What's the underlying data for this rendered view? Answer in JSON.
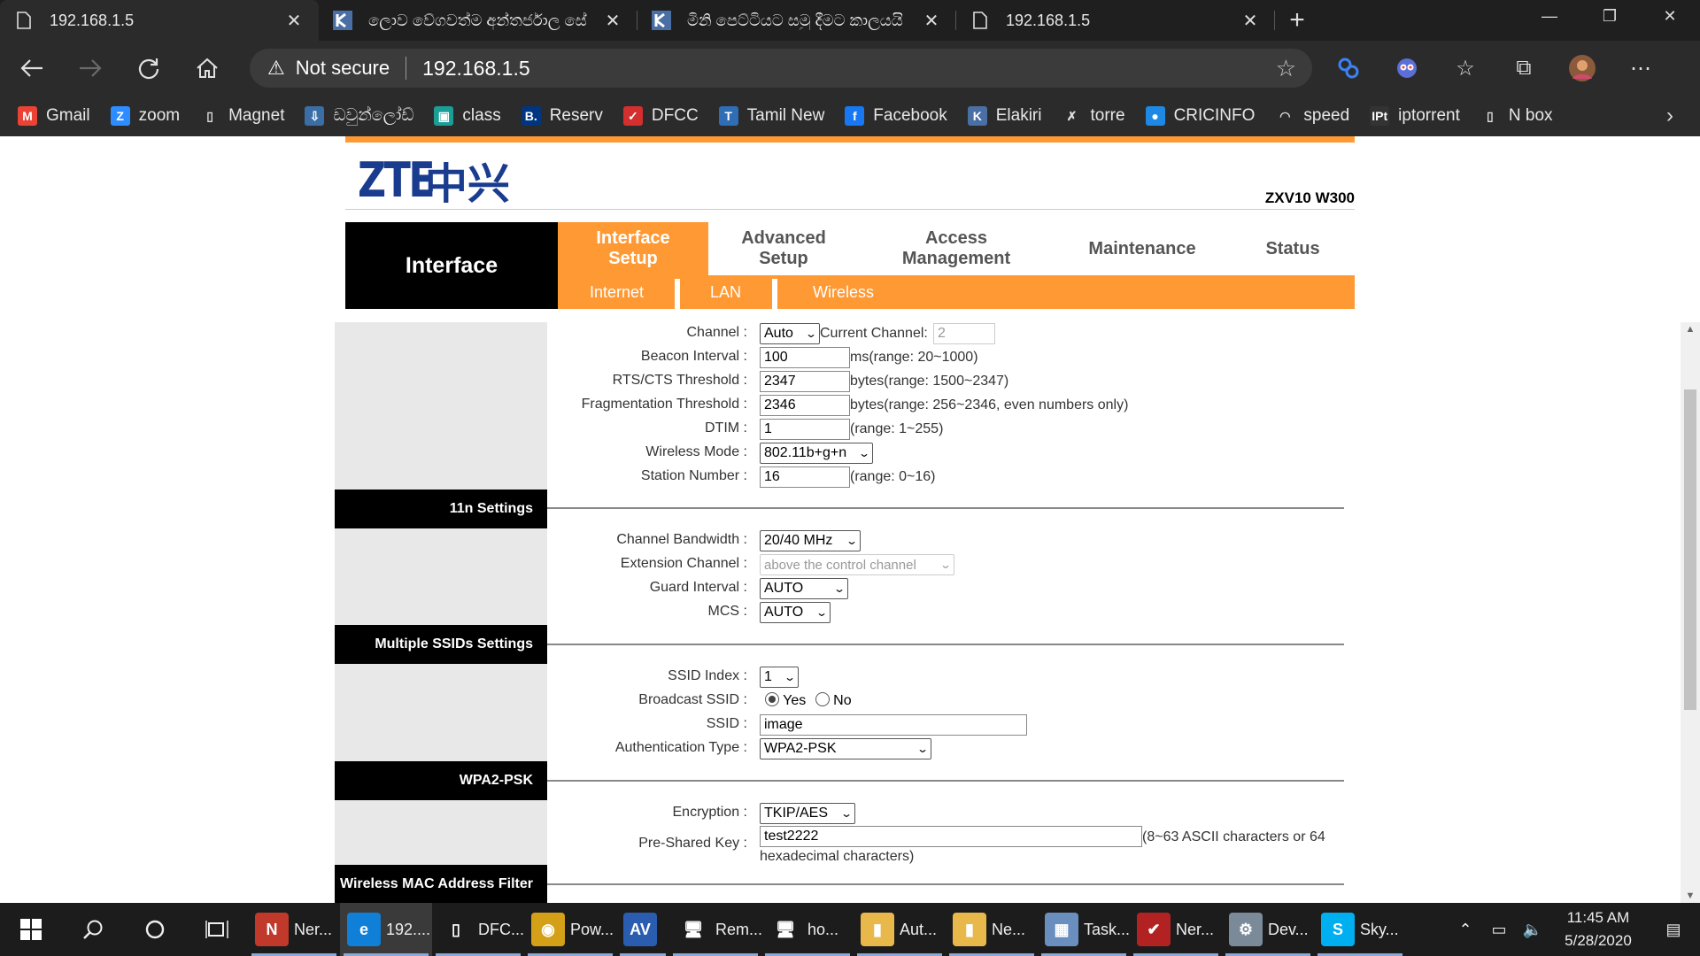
{
  "browser": {
    "tabs": [
      {
        "title": "192.168.1.5",
        "icon": "page-icon",
        "active": true
      },
      {
        "title": "ලොව වේගවත්ම අන්තර්ජාල සේ",
        "icon": "k-logo-icon",
        "active": false
      },
      {
        "title": "මිනි පෙට්ටියට සමු දීමට කාලයයි",
        "icon": "k-logo-icon",
        "active": false
      },
      {
        "title": "192.168.1.5",
        "icon": "page-icon",
        "active": false
      }
    ],
    "tab_close": "✕",
    "new_tab": "+",
    "window_controls": {
      "minimize": "—",
      "maximize": "❐",
      "close": "✕"
    },
    "address": {
      "security": "Not secure",
      "url": "192.168.1.5"
    },
    "bookmarks": [
      {
        "label": "Gmail",
        "icon": "gmail-icon",
        "color": "#ea4335",
        "glyph": "M"
      },
      {
        "label": "zoom",
        "icon": "zoom-icon",
        "color": "#2d8cff",
        "glyph": "Z"
      },
      {
        "label": "Magnet",
        "icon": "page-icon",
        "color": "transparent",
        "glyph": "▯"
      },
      {
        "label": "ඩවුන්ලෝඩ්",
        "icon": "download-icon",
        "color": "#3a6ea5",
        "glyph": "⇩"
      },
      {
        "label": "class",
        "icon": "class-icon",
        "color": "#1a9e96",
        "glyph": "▣"
      },
      {
        "label": "Reserv",
        "icon": "booking-icon",
        "color": "#003580",
        "glyph": "B."
      },
      {
        "label": "DFCC",
        "icon": "check-icon",
        "color": "#d32f2f",
        "glyph": "✓"
      },
      {
        "label": "Tamil New",
        "icon": "t-logo-icon",
        "color": "#2f6db5",
        "glyph": "T"
      },
      {
        "label": "Facebook",
        "icon": "facebook-icon",
        "color": "#1877f2",
        "glyph": "f"
      },
      {
        "label": "Elakiri",
        "icon": "k-logo-icon",
        "color": "#4a6fa5",
        "glyph": "K"
      },
      {
        "label": "torre",
        "icon": "x-logo-icon",
        "color": "transparent",
        "glyph": "✗"
      },
      {
        "label": "CRICINFO",
        "icon": "cricinfo-icon",
        "color": "#1e88e5",
        "glyph": "●"
      },
      {
        "label": "speed",
        "icon": "speed-icon",
        "color": "transparent",
        "glyph": "◠"
      },
      {
        "label": "iptorrent",
        "icon": "ipt-icon",
        "color": "#333333",
        "glyph": "IPt"
      },
      {
        "label": "N box",
        "icon": "page-icon",
        "color": "transparent",
        "glyph": "▯"
      }
    ]
  },
  "router": {
    "logo_text": "ZTE",
    "logo_cn": "中兴",
    "model": "ZXV10 W300",
    "menu_left": "Interface",
    "menu": [
      {
        "label": "Interface Setup",
        "active": true
      },
      {
        "label": "Advanced Setup",
        "active": false
      },
      {
        "label": "Access Management",
        "active": false
      },
      {
        "label": "Maintenance",
        "active": false
      },
      {
        "label": "Status",
        "active": false
      }
    ],
    "submenu": [
      "Internet",
      "LAN",
      "Wireless"
    ],
    "accent_color": "#ff9933",
    "wireless": {
      "channel": {
        "label": "Channel",
        "value": "Auto",
        "current_label": "Current Channel:",
        "current_value": "2"
      },
      "beacon": {
        "label": "Beacon Interval",
        "value": "100",
        "hint": "ms(range: 20~1000)"
      },
      "rts": {
        "label": "RTS/CTS Threshold",
        "value": "2347",
        "hint": "bytes(range: 1500~2347)"
      },
      "frag": {
        "label": "Fragmentation Threshold",
        "value": "2346",
        "hint": "bytes(range: 256~2346, even numbers only)"
      },
      "dtim": {
        "label": "DTIM",
        "value": "1",
        "hint": "(range: 1~255)"
      },
      "mode": {
        "label": "Wireless Mode",
        "value": "802.11b+g+n"
      },
      "station": {
        "label": "Station Number",
        "value": "16",
        "hint": "(range: 0~16)"
      }
    },
    "n_settings": {
      "title": "11n Settings",
      "bandwidth": {
        "label": "Channel Bandwidth",
        "value": "20/40 MHz"
      },
      "ext_channel": {
        "label": "Extension Channel",
        "value": "above the control channel"
      },
      "guard": {
        "label": "Guard Interval",
        "value": "AUTO"
      },
      "mcs": {
        "label": "MCS",
        "value": "AUTO"
      }
    },
    "ssid_settings": {
      "title": "Multiple SSIDs Settings",
      "index": {
        "label": "SSID Index",
        "value": "1"
      },
      "broadcast": {
        "label": "Broadcast SSID",
        "yes": "Yes",
        "no": "No",
        "selected": "Yes"
      },
      "ssid": {
        "label": "SSID",
        "value": "image"
      },
      "auth": {
        "label": "Authentication Type",
        "value": "WPA2-PSK"
      }
    },
    "wpa": {
      "title": "WPA2-PSK",
      "encryption": {
        "label": "Encryption",
        "value": "TKIP/AES"
      },
      "psk": {
        "label": "Pre-Shared Key",
        "value": "test2222",
        "hint1": "(8~63 ASCII characters or 64",
        "hint2": "hexadecimal characters)"
      }
    },
    "mac_filter": {
      "title": "Wireless MAC Address Filter"
    },
    "colon": ":"
  },
  "taskbar": {
    "apps": [
      {
        "label": "Ner...",
        "icon": "nero-icon",
        "color": "#c0392b",
        "glyph": "N",
        "active": false
      },
      {
        "label": "192....",
        "icon": "edge-icon",
        "color": "#0f7fd8",
        "glyph": "e",
        "active": true
      },
      {
        "label": "DFC...",
        "icon": "document-icon",
        "color": "transparent",
        "glyph": "▯",
        "active": false
      },
      {
        "label": "Pow...",
        "icon": "power-dvd-icon",
        "color": "#d4a017",
        "glyph": "◉",
        "active": false
      },
      {
        "label": "",
        "icon": "nero-av-icon",
        "color": "#2a5db0",
        "glyph": "AV",
        "active": false
      },
      {
        "label": "Rem...",
        "icon": "remote-desktop-icon",
        "color": "transparent",
        "glyph": "🖥",
        "active": false
      },
      {
        "label": "ho...",
        "icon": "remote-desktop-icon",
        "color": "transparent",
        "glyph": "🖥",
        "active": false
      },
      {
        "label": "Aut...",
        "icon": "folder-icon",
        "color": "#e8b84a",
        "glyph": "▮",
        "active": false
      },
      {
        "label": "Ne...",
        "icon": "folder-icon",
        "color": "#e8b84a",
        "glyph": "▮",
        "active": false
      },
      {
        "label": "Task...",
        "icon": "task-manager-icon",
        "color": "#6a8fbf",
        "glyph": "▦",
        "active": false
      },
      {
        "label": "Ner...",
        "icon": "nero-express-icon",
        "color": "#b22222",
        "glyph": "✔",
        "active": false
      },
      {
        "label": "Dev...",
        "icon": "device-manager-icon",
        "color": "#7a8a99",
        "glyph": "⚙",
        "active": false
      },
      {
        "label": "Sky...",
        "icon": "skype-icon",
        "color": "#00aff0",
        "glyph": "S",
        "active": false
      }
    ],
    "time": "11:45 AM",
    "date": "5/28/2020"
  }
}
